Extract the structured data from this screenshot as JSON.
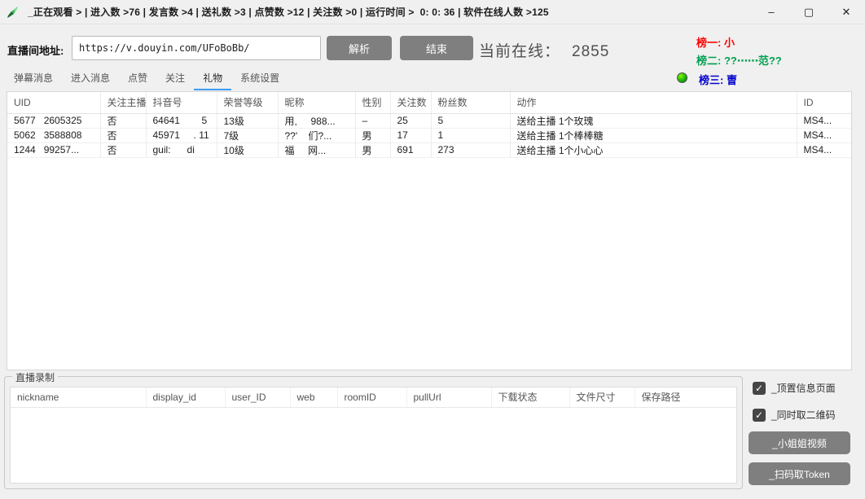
{
  "window": {
    "title": "_正在观看 > | 进入数 >76 | 发言数 >4 | 送礼数 >3 | 点赞数 >12 | 关注数 >0 | 运行时间 >  0: 0: 36 | 软件在线人数 >125",
    "controls": {
      "minimize": "–",
      "maximize": "▢",
      "close": "✕"
    }
  },
  "toolbar": {
    "url_label": "直播间地址:",
    "url_value": "https://v.douyin.com/UFoBoBb/",
    "parse_button": "解析",
    "stop_button": "结束",
    "online_label": "当前在线：",
    "online_count": "2855"
  },
  "leaderboard": {
    "rank1": {
      "label": "榜一: 小",
      "color": "#ff0000"
    },
    "rank2": {
      "label": "榜二: ??⋯⋯范??",
      "color": "#00a050"
    },
    "rank3": {
      "label": "榜三: 曺",
      "color": "#0000cc"
    }
  },
  "tabs": [
    {
      "label": "弹幕消息"
    },
    {
      "label": "进入消息"
    },
    {
      "label": "点赞"
    },
    {
      "label": "关注"
    },
    {
      "label": "礼物"
    },
    {
      "label": "系统设置"
    }
  ],
  "active_tab": "礼物",
  "gift_table": {
    "headers": [
      "UID",
      "关注主播",
      "抖音号",
      "荣誉等级",
      "昵称",
      "性别",
      "关注数",
      "粉丝数",
      "动作",
      "ID"
    ],
    "rows": [
      {
        "uid": "5677   2605325",
        "follow": "否",
        "douyin_id": "64641        5",
        "level": "13级",
        "nickname": "用,     988...",
        "gender": "–",
        "follows": "25",
        "fans": "5",
        "action": "送给主播 1个玫瑰",
        "id": "MS4..."
      },
      {
        "uid": "5062   3588808",
        "follow": "否",
        "douyin_id": "45971     . 11",
        "level": "7级",
        "nickname": "??'    们?...",
        "gender": "男",
        "follows": "17",
        "fans": "1",
        "action": "送给主播 1个棒棒糖",
        "id": "MS4..."
      },
      {
        "uid": "1244   99257...",
        "follow": "否",
        "douyin_id": "guil:      di",
        "level": "10级",
        "nickname": "福     网...",
        "gender": "男",
        "follows": "691",
        "fans": "273",
        "action": "送给主播 1个小心心",
        "id": "MS4..."
      }
    ]
  },
  "recording": {
    "group_label": "直播录制",
    "headers": [
      "nickname",
      "display_id",
      "user_ID",
      "web",
      "roomID",
      "pullUrl",
      "下载状态",
      "文件尺寸",
      "保存路径"
    ]
  },
  "right_panel": {
    "checkbox_pin_info": {
      "label": "_顶置信息页面",
      "checked": true,
      "check_glyph": "✓"
    },
    "checkbox_qrcode": {
      "label": "_同时取二维码",
      "checked": true,
      "check_glyph": "✓"
    },
    "video_button": "_小姐姐视频",
    "token_button": "_扫码取Token"
  }
}
